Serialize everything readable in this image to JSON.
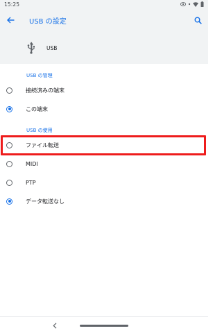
{
  "status_bar": {
    "time": "15:25",
    "icons": [
      "eye-icon",
      "dot-icon",
      "wifi-icon",
      "battery-icon"
    ]
  },
  "app_bar": {
    "title": "USB の設定",
    "back_icon": "arrow-back-icon",
    "search_icon": "search-icon"
  },
  "device_header": {
    "icon": "usb-icon",
    "label": "USB"
  },
  "sections": [
    {
      "header": "USB の管理",
      "options": [
        {
          "label": "接続済みの端末",
          "checked": false
        },
        {
          "label": "この端末",
          "checked": true
        }
      ]
    },
    {
      "header": "USB の使用",
      "options": [
        {
          "label": "ファイル転送",
          "checked": false
        },
        {
          "label": "MIDI",
          "checked": false
        },
        {
          "label": "PTP",
          "checked": false
        },
        {
          "label": "データ転送なし",
          "checked": true
        }
      ]
    }
  ],
  "nav_bar": {
    "back_icon": "chevron-left-icon",
    "home_handle": "home-handle"
  },
  "colors": {
    "accent": "#1a73e8",
    "highlight": "#ee1c1c",
    "header_bg": "#f1f3f4"
  }
}
